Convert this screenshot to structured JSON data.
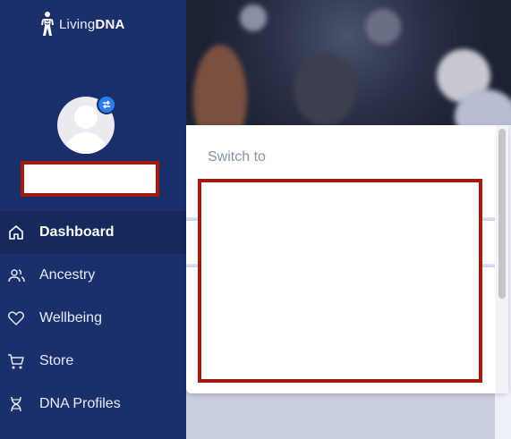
{
  "brand": {
    "logo_light": "Living",
    "logo_bold": "DNA"
  },
  "profile": {
    "name": ""
  },
  "nav": {
    "items": [
      {
        "label": "Dashboard",
        "icon": "home-icon",
        "active": true
      },
      {
        "label": "Ancestry",
        "icon": "people-icon",
        "active": false
      },
      {
        "label": "Wellbeing",
        "icon": "heart-icon",
        "active": false
      },
      {
        "label": "Store",
        "icon": "cart-icon",
        "active": false
      },
      {
        "label": "DNA Profiles",
        "icon": "dna-icon",
        "active": false
      }
    ]
  },
  "switcher": {
    "title": "Switch to",
    "profiles": []
  },
  "colors": {
    "sidebar": "#1b2f6b",
    "active_item": "#15295d",
    "accent": "#2b7cf0",
    "redaction": "#a21a10"
  }
}
